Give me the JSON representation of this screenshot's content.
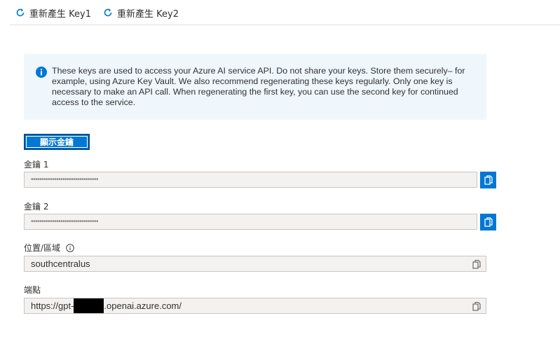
{
  "toolbar": {
    "regen_key1": "重新產生 Key1",
    "regen_key2": "重新產生 Key2"
  },
  "info_banner": {
    "text": "These keys are used to access your Azure AI service API. Do not share your keys. Store them securely– for example, using Azure Key Vault. We also recommend regenerating these keys regularly. Only one key is necessary to make an API call. When regenerating the first key, you can use the second key for continued access to the service."
  },
  "reveal_button": "顯示金鑰",
  "key1": {
    "label": "金鑰 1",
    "value": "••••••••••••••••••••••••••••••••"
  },
  "key2": {
    "label": "金鑰 2",
    "value": "••••••••••••••••••••••••••••••••"
  },
  "location": {
    "label": "位置/區域",
    "value": "southcentralus"
  },
  "endpoint": {
    "label": "端點",
    "value_prefix": "https://gpt-",
    "value_suffix": ".openai.azure.com/"
  },
  "colors": {
    "accent": "#0078d4",
    "info_bg": "#eff6fc"
  },
  "icons": [
    "refresh-icon",
    "info-icon",
    "copy-icon"
  ]
}
